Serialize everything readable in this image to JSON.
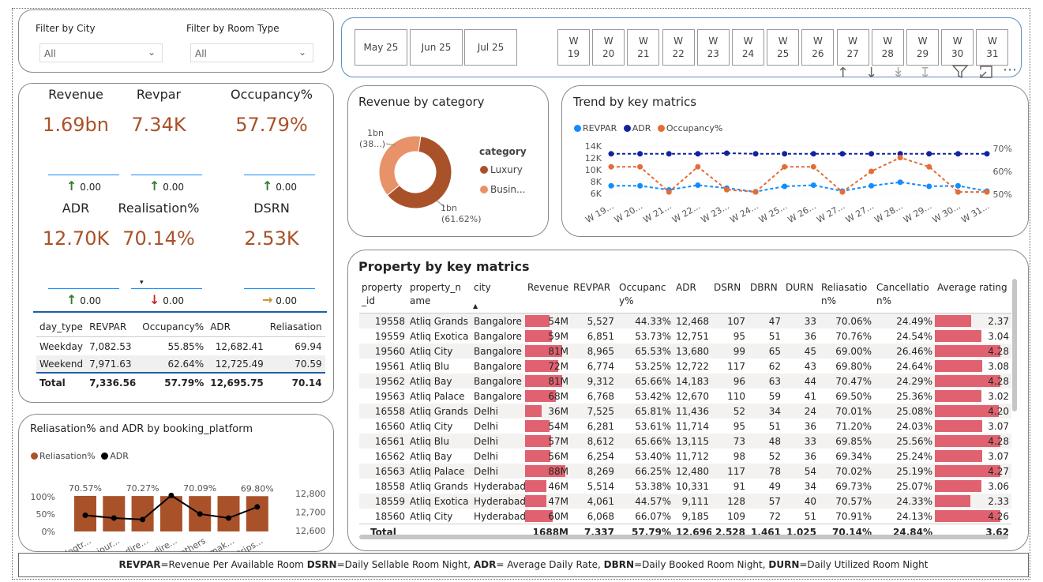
{
  "filters": {
    "city_label": "Filter by City",
    "city_value": "All",
    "room_label": "Filter by Room Type",
    "room_value": "All"
  },
  "date_slicer": {
    "months": [
      "May 25",
      "Jun 25",
      "Jul 25"
    ],
    "weeks": [
      {
        "l1": "W",
        "l2": "19"
      },
      {
        "l1": "W",
        "l2": "20"
      },
      {
        "l1": "W",
        "l2": "21"
      },
      {
        "l1": "W",
        "l2": "22"
      },
      {
        "l1": "W",
        "l2": "23"
      },
      {
        "l1": "W",
        "l2": "24"
      },
      {
        "l1": "W",
        "l2": "25"
      },
      {
        "l1": "W",
        "l2": "26"
      },
      {
        "l1": "W",
        "l2": "27"
      },
      {
        "l1": "W",
        "l2": "28"
      },
      {
        "l1": "W",
        "l2": "29"
      },
      {
        "l1": "W",
        "l2": "30"
      },
      {
        "l1": "W",
        "l2": "31"
      }
    ]
  },
  "kpis": [
    {
      "label": "Revenue",
      "value": "1.69bn",
      "delta": "0.00",
      "arrow": "up",
      "arrow_color": "#2e7d32"
    },
    {
      "label": "Revpar",
      "value": "7.34K",
      "delta": "0.00",
      "arrow": "up",
      "arrow_color": "#2e7d32"
    },
    {
      "label": "Occupancy%",
      "value": "57.79%",
      "delta": "0.00",
      "arrow": "up",
      "arrow_color": "#2e7d32"
    },
    {
      "label": "ADR",
      "value": "12.70K",
      "delta": "0.00",
      "arrow": "up",
      "arrow_color": "#2e7d32"
    },
    {
      "label": "Realisation%",
      "value": "70.14%",
      "delta": "0.00",
      "arrow": "down",
      "arrow_color": "#c62828"
    },
    {
      "label": "DSRN",
      "value": "2.53K",
      "delta": "0.00",
      "arrow": "right",
      "arrow_color": "#c8922a"
    }
  ],
  "day_type_table": {
    "headers": [
      "day_type",
      "REVPAR",
      "Occupancy%",
      "ADR",
      "Reliasation"
    ],
    "rows": [
      [
        "Weekday",
        "7,082.53",
        "55.85%",
        "12,682.41",
        "69.94"
      ],
      [
        "Weekend",
        "7,971.63",
        "62.64%",
        "12,725.49",
        "70.59"
      ]
    ],
    "total": [
      "Total",
      "7,336.56",
      "57.79%",
      "12,695.75",
      "70.14"
    ]
  },
  "revenue_by_category": {
    "title": "Revenue by category",
    "legend_title": "category",
    "labels": [
      {
        "line1": "1bn",
        "line2": "(38...)"
      },
      {
        "line1": "1bn",
        "line2": "(61.62%)"
      }
    ],
    "colors": {
      "luxury": "#a9522a",
      "business": "#e8926a"
    }
  },
  "trend": {
    "title": "Trend by key matrics",
    "colors": {
      "revpar": "#118dff",
      "adr": "#12239e",
      "occ": "#e66c37"
    }
  },
  "platform": {
    "title": "Reliasation% and ADR by booking_platform",
    "colors": {
      "bar": "#a9522a",
      "line": "#000000"
    }
  },
  "property": {
    "title": "Property by key matrics",
    "headers": [
      [
        "property",
        "_id"
      ],
      [
        "property_n",
        "ame"
      ],
      [
        "city",
        ""
      ],
      [
        "Revenue",
        ""
      ],
      [
        "REVPAR",
        ""
      ],
      [
        "Occupanc",
        "y%"
      ],
      [
        "ADR",
        ""
      ],
      [
        "DSRN",
        ""
      ],
      [
        "DBRN",
        ""
      ],
      [
        "DURN",
        ""
      ],
      [
        "Reliasatio",
        "n%"
      ],
      [
        "Cancellatio",
        "n%"
      ],
      [
        "Average rating",
        ""
      ]
    ],
    "rows": [
      {
        "id": "19558",
        "name": "Atliq Grands",
        "city": "Bangalore",
        "rev": "54M",
        "revpar": "5,527",
        "occ": "44.33%",
        "adr": "12,468",
        "dsrn": "107",
        "dbrn": "47",
        "durn": "33",
        "real": "70.06%",
        "canc": "24.49%",
        "rating": "2.37",
        "rev_m": 54,
        "rating_n": 2.37
      },
      {
        "id": "19559",
        "name": "Atliq Exotica",
        "city": "Bangalore",
        "rev": "59M",
        "revpar": "6,851",
        "occ": "53.73%",
        "adr": "12,751",
        "dsrn": "95",
        "dbrn": "51",
        "durn": "36",
        "real": "70.76%",
        "canc": "24.54%",
        "rating": "3.04",
        "rev_m": 59,
        "rating_n": 3.04
      },
      {
        "id": "19560",
        "name": "Atliq City",
        "city": "Bangalore",
        "rev": "81M",
        "revpar": "8,965",
        "occ": "65.53%",
        "adr": "13,680",
        "dsrn": "99",
        "dbrn": "65",
        "durn": "45",
        "real": "69.00%",
        "canc": "26.46%",
        "rating": "4.28",
        "rev_m": 81,
        "rating_n": 4.28
      },
      {
        "id": "19561",
        "name": "Atliq Blu",
        "city": "Bangalore",
        "rev": "72M",
        "revpar": "6,774",
        "occ": "53.25%",
        "adr": "12,722",
        "dsrn": "117",
        "dbrn": "62",
        "durn": "43",
        "real": "69.80%",
        "canc": "24.64%",
        "rating": "3.08",
        "rev_m": 72,
        "rating_n": 3.08
      },
      {
        "id": "19562",
        "name": "Atliq Bay",
        "city": "Bangalore",
        "rev": "81M",
        "revpar": "9,312",
        "occ": "65.66%",
        "adr": "14,183",
        "dsrn": "96",
        "dbrn": "63",
        "durn": "44",
        "real": "70.47%",
        "canc": "24.29%",
        "rating": "4.28",
        "rev_m": 81,
        "rating_n": 4.28
      },
      {
        "id": "19563",
        "name": "Atliq Palace",
        "city": "Bangalore",
        "rev": "68M",
        "revpar": "6,768",
        "occ": "53.42%",
        "adr": "12,670",
        "dsrn": "110",
        "dbrn": "59",
        "durn": "41",
        "real": "69.50%",
        "canc": "25.36%",
        "rating": "3.02",
        "rev_m": 68,
        "rating_n": 3.02
      },
      {
        "id": "16558",
        "name": "Atliq Grands",
        "city": "Delhi",
        "rev": "36M",
        "revpar": "7,525",
        "occ": "65.81%",
        "adr": "11,436",
        "dsrn": "52",
        "dbrn": "34",
        "durn": "24",
        "real": "70.01%",
        "canc": "25.08%",
        "rating": "4.20",
        "rev_m": 36,
        "rating_n": 4.2
      },
      {
        "id": "16560",
        "name": "Atliq City",
        "city": "Delhi",
        "rev": "54M",
        "revpar": "6,281",
        "occ": "53.61%",
        "adr": "11,714",
        "dsrn": "95",
        "dbrn": "51",
        "durn": "36",
        "real": "71.20%",
        "canc": "24.03%",
        "rating": "3.07",
        "rev_m": 54,
        "rating_n": 3.07
      },
      {
        "id": "16561",
        "name": "Atliq Blu",
        "city": "Delhi",
        "rev": "57M",
        "revpar": "8,612",
        "occ": "65.66%",
        "adr": "13,115",
        "dsrn": "73",
        "dbrn": "48",
        "durn": "33",
        "real": "69.85%",
        "canc": "25.56%",
        "rating": "4.28",
        "rev_m": 57,
        "rating_n": 4.28
      },
      {
        "id": "16562",
        "name": "Atliq Bay",
        "city": "Delhi",
        "rev": "56M",
        "revpar": "6,254",
        "occ": "53.40%",
        "adr": "11,712",
        "dsrn": "98",
        "dbrn": "52",
        "durn": "36",
        "real": "69.34%",
        "canc": "25.24%",
        "rating": "3.07",
        "rev_m": 56,
        "rating_n": 3.07
      },
      {
        "id": "16563",
        "name": "Atliq Palace",
        "city": "Delhi",
        "rev": "88M",
        "revpar": "8,269",
        "occ": "66.25%",
        "adr": "12,480",
        "dsrn": "117",
        "dbrn": "78",
        "durn": "54",
        "real": "70.02%",
        "canc": "25.19%",
        "rating": "4.27",
        "rev_m": 88,
        "rating_n": 4.27
      },
      {
        "id": "18558",
        "name": "Atliq Grands",
        "city": "Hyderabad",
        "rev": "46M",
        "revpar": "5,514",
        "occ": "53.38%",
        "adr": "10,331",
        "dsrn": "91",
        "dbrn": "49",
        "durn": "34",
        "real": "69.73%",
        "canc": "25.07%",
        "rating": "3.06",
        "rev_m": 46,
        "rating_n": 3.06
      },
      {
        "id": "18559",
        "name": "Atliq Exotica",
        "city": "Hyderabad",
        "rev": "47M",
        "revpar": "4,061",
        "occ": "44.57%",
        "adr": "9,111",
        "dsrn": "128",
        "dbrn": "57",
        "durn": "40",
        "real": "70.57%",
        "canc": "24.33%",
        "rating": "2.33",
        "rev_m": 47,
        "rating_n": 2.33
      },
      {
        "id": "18560",
        "name": "Atliq City",
        "city": "Hyderabad",
        "rev": "60M",
        "revpar": "6,068",
        "occ": "66.07%",
        "adr": "9,185",
        "dsrn": "109",
        "dbrn": "72",
        "durn": "51",
        "real": "70.91%",
        "canc": "24.13%",
        "rating": "4.26",
        "rev_m": 60,
        "rating_n": 4.26
      }
    ],
    "total": {
      "label": "Total",
      "rev": "1688M",
      "revpar": "7,337",
      "occ": "57.79%",
      "adr": "12,696",
      "dsrn": "2,528",
      "dbrn": "1,461",
      "durn": "1,025",
      "real": "70.14%",
      "canc": "24.84%",
      "rating": "3.62"
    }
  },
  "footer": {
    "k1": "REVPAR",
    "v1": "=Revenue Per Available Room  ",
    "k2": "DSRN",
    "v2": "=Daily Sellable Room Night, ",
    "k3": "ADR",
    "v3": "= Average Daily Rate, ",
    "k4": "DBRN",
    "v4": "=Daily Booked Room Night, ",
    "k5": "DURN",
    "v5": "=Daily Utilized Room Night"
  },
  "chart_data": [
    {
      "type": "pie",
      "title": "Revenue by category",
      "legend_title": "category",
      "categories": [
        "Luxury",
        "Busin..."
      ],
      "values": [
        61.62,
        38.38
      ],
      "value_labels": [
        "1bn (61.62%)",
        "1bn (38...)"
      ]
    },
    {
      "type": "line",
      "title": "Trend by key matrics",
      "categories": [
        "W 19...",
        "W 20...",
        "W 21...",
        "W 22...",
        "W 23...",
        "W 24...",
        "W 25...",
        "W 26...",
        "W 27...",
        "W 27...",
        "W 28...",
        "W 29...",
        "W 30...",
        "W 31..."
      ],
      "y_ticks": [
        "14K",
        "12K",
        "10K",
        "8K",
        "6K"
      ],
      "y2_ticks": [
        "70%",
        "60%",
        "50%"
      ],
      "ylim": [
        5000,
        15000
      ],
      "y2lim": [
        45,
        73
      ],
      "series": [
        {
          "name": "REVPAR",
          "axis": "left",
          "values": [
            7300,
            7300,
            6600,
            7400,
            6900,
            6300,
            7200,
            7400,
            6400,
            7300,
            7900,
            7200,
            7300,
            6400
          ]
        },
        {
          "name": "ADR",
          "axis": "left",
          "values": [
            12700,
            12700,
            12700,
            12700,
            12800,
            12700,
            12700,
            12700,
            12700,
            12700,
            12700,
            12700,
            12700,
            12700
          ]
        },
        {
          "name": "Occupancy%",
          "axis": "right",
          "values": [
            62,
            62,
            51,
            62,
            52,
            51,
            62,
            62,
            51,
            60,
            66,
            62,
            51,
            51
          ]
        }
      ]
    },
    {
      "type": "bar",
      "title": "Reliasation% and ADR by booking_platform",
      "categories": [
        "logtr...",
        "jour...",
        "dire...",
        "dire...",
        "others",
        "mak...",
        "trips..."
      ],
      "y_ticks": [
        "100%",
        "50%",
        "0%"
      ],
      "y2_ticks": [
        "12,800",
        "12,700",
        "12,600"
      ],
      "ylim": [
        0,
        100
      ],
      "y2lim": [
        12560,
        12820
      ],
      "series": [
        {
          "name": "Reliasation%",
          "values": [
            70.57,
            70.1,
            70.27,
            70.05,
            70.09,
            70.2,
            69.8
          ],
          "value_labels": [
            "70.57%",
            "",
            "70.27%",
            "",
            "70.09%",
            "",
            "69.80%"
          ]
        },
        {
          "name": "ADR",
          "values": [
            12683,
            12668,
            12660,
            12790,
            12690,
            12668,
            12728
          ]
        }
      ]
    }
  ]
}
